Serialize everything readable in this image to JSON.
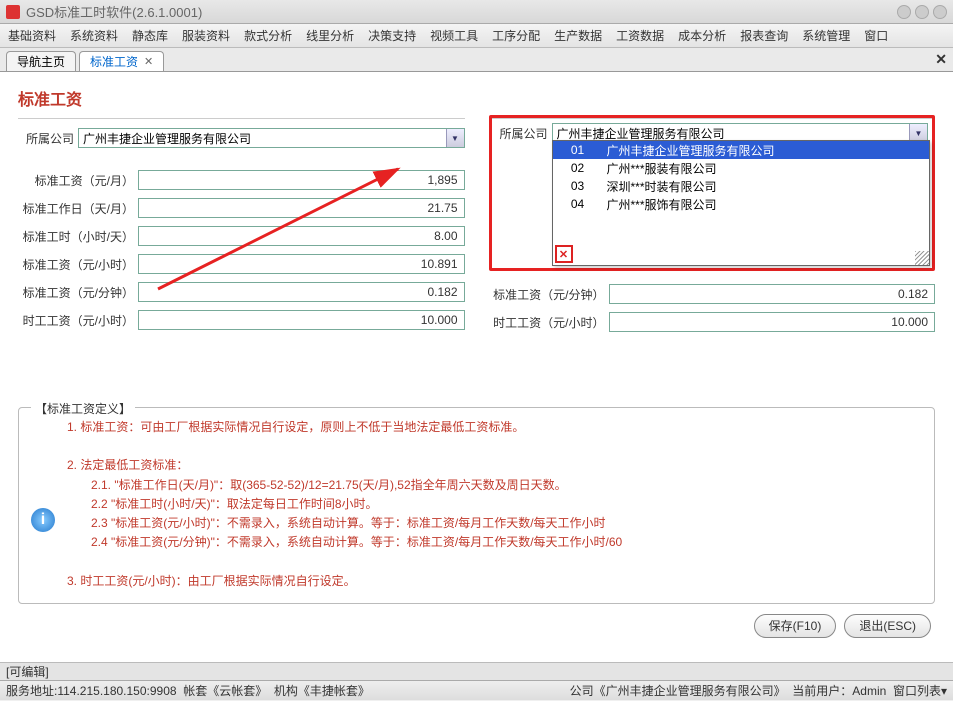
{
  "window": {
    "title": "GSD标准工时软件(2.6.1.0001)"
  },
  "menu": [
    "基础资料",
    "系统资料",
    "静态库",
    "服装资料",
    "款式分析",
    "线里分析",
    "决策支持",
    "视频工具",
    "工序分配",
    "生产数据",
    "工资数据",
    "成本分析",
    "报表查询",
    "系统管理",
    "窗口"
  ],
  "tabs": {
    "nav": "导航主页",
    "current": "标准工资"
  },
  "page": {
    "title": "标准工资"
  },
  "form": {
    "company_label": "所属公司",
    "company_value": "广州丰捷企业管理服务有限公司",
    "rows": [
      {
        "label": "标准工资（元/月）",
        "value": "1,895"
      },
      {
        "label": "标准工作日（天/月）",
        "value": "21.75"
      },
      {
        "label": "标准工时（小时/天）",
        "value": "8.00"
      },
      {
        "label": "标准工资（元/小时）",
        "value": "10.891"
      },
      {
        "label": "标准工资（元/分钟）",
        "value": "0.182"
      },
      {
        "label": "时工工资（元/小时）",
        "value": "10.000"
      }
    ],
    "right_rows": [
      {
        "label": "标准工资（元/分钟）",
        "value": "0.182"
      },
      {
        "label": "时工工资（元/小时）",
        "value": "10.000"
      }
    ]
  },
  "dropdown": {
    "options": [
      {
        "code": "01",
        "name": "广州丰捷企业管理服务有限公司"
      },
      {
        "code": "02",
        "name": "广州***服装有限公司"
      },
      {
        "code": "03",
        "name": "深圳***时装有限公司"
      },
      {
        "code": "04",
        "name": "广州***服饰有限公司"
      }
    ]
  },
  "definition": {
    "title": "【标准工资定义】",
    "l1": "1. 标准工资：可由工厂根据实际情况自行设定，原则上不低于当地法定最低工资标准。",
    "l2": "2. 法定最低工资标准：",
    "l2_1": "2.1. \"标准工作日(天/月)\"：取(365-52-52)/12=21.75(天/月),52指全年周六天数及周日天数。",
    "l2_2": "2.2  \"标准工时(小时/天)\"：取法定每日工作时间8小时。",
    "l2_3": "2.3  \"标准工资(元/小时)\"：不需录入，系统自动计算。等于：标准工资/每月工作天数/每天工作小时",
    "l2_4": "2.4  \"标准工资(元/分钟)\"：不需录入，系统自动计算。等于：标准工资/每月工作天数/每天工作小时/60",
    "l3": "3. 时工工资(元/小时)：由工厂根据实际情况自行设定。"
  },
  "buttons": {
    "save": "保存(F10)",
    "exit": "退出(ESC)"
  },
  "ready": "[可编辑]",
  "status": {
    "server": "服务地址:114.215.180.150:9908",
    "account": "帐套《云帐套》",
    "org": "机构《丰捷帐套》",
    "company": "公司《广州丰捷企业管理服务有限公司》",
    "user": "当前用户：Admin",
    "winlist": "窗口列表▾"
  }
}
